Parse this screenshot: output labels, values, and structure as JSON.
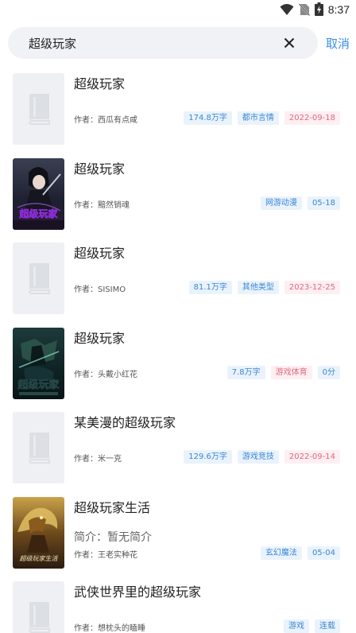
{
  "status_bar": {
    "time": "8:37"
  },
  "search": {
    "query": "超级玩家",
    "cancel_label": "取消"
  },
  "results": [
    {
      "title": "超级玩家",
      "author": "作者：西瓜有点咸",
      "intro": "",
      "cover": "placeholder",
      "tags": [
        {
          "text": "174.8万字",
          "color": "blue"
        },
        {
          "text": "都市言情",
          "color": "blue"
        },
        {
          "text": "2022-09-18",
          "color": "red"
        }
      ]
    },
    {
      "title": "超级玩家",
      "author": "作者：黯然销魂",
      "intro": "",
      "cover": "art-dark-warrior",
      "cover_text": "超级玩家",
      "tags": [
        {
          "text": "网游动漫",
          "color": "blue"
        },
        {
          "text": "05-18",
          "color": "blue"
        }
      ]
    },
    {
      "title": "超级玩家",
      "author": "作者：SISIMO",
      "intro": "",
      "cover": "placeholder",
      "tags": [
        {
          "text": "81.1万字",
          "color": "blue"
        },
        {
          "text": "其他类型",
          "color": "blue"
        },
        {
          "text": "2023-12-25",
          "color": "red"
        }
      ]
    },
    {
      "title": "超级玩家",
      "author": "作者：头戴小红花",
      "intro": "",
      "cover": "art-green-warrior",
      "cover_text": "超级玩家",
      "tags": [
        {
          "text": "7.8万字",
          "color": "blue"
        },
        {
          "text": "游戏体育",
          "color": "red"
        },
        {
          "text": "0分",
          "color": "blue"
        }
      ]
    },
    {
      "title": "某美漫的超级玩家",
      "author": "作者：米一克",
      "intro": "",
      "cover": "placeholder",
      "tags": [
        {
          "text": "129.6万字",
          "color": "blue"
        },
        {
          "text": "游戏竞技",
          "color": "blue"
        },
        {
          "text": "2022-09-14",
          "color": "red"
        }
      ]
    },
    {
      "title": "超级玩家生活",
      "author": "作者：王老实种花",
      "intro": "简介：暂无简介",
      "cover": "art-golden-dragon",
      "cover_text": "超级玩家生活",
      "tags": [
        {
          "text": "玄幻魔法",
          "color": "blue"
        },
        {
          "text": "05-04",
          "color": "blue"
        }
      ]
    },
    {
      "title": "武侠世界里的超级玩家",
      "author": "作者：想枕头的瞌睡",
      "intro": "",
      "cover": "placeholder",
      "tags": [
        {
          "text": "游戏",
          "color": "blue"
        },
        {
          "text": "连载",
          "color": "blue"
        }
      ]
    }
  ],
  "colors": {
    "accent": "#3a8ee6",
    "tag_blue_bg": "#eaf3fc",
    "tag_blue_fg": "#3a87d6",
    "tag_red_bg": "#fdeff2",
    "tag_red_fg": "#e06a7e"
  }
}
